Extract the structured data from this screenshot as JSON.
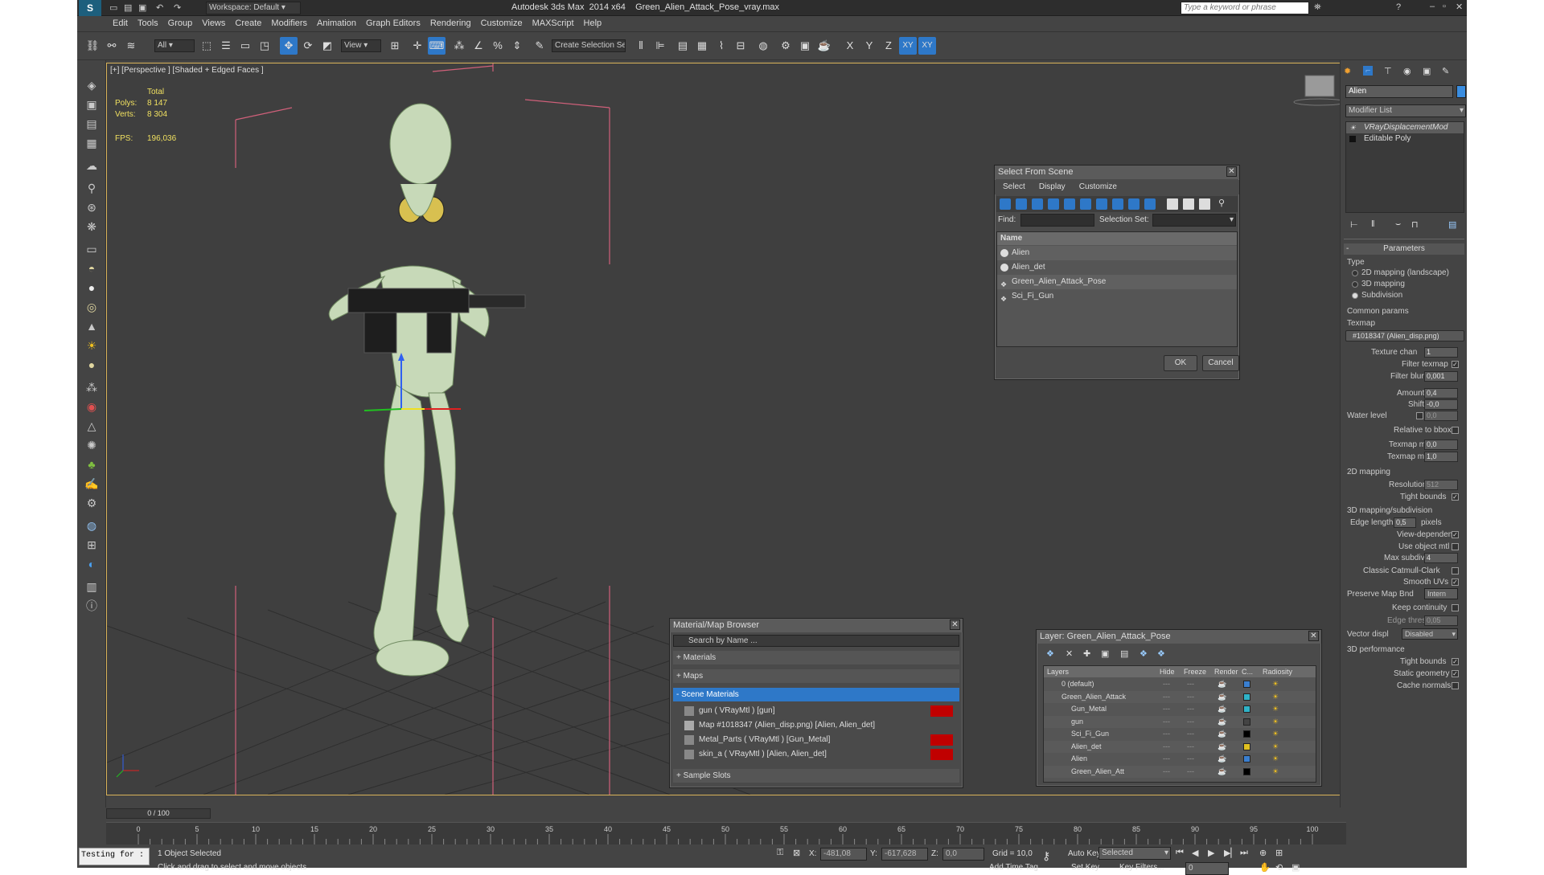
{
  "title": {
    "app": "Autodesk 3ds Max  2014 x64    Green_Alien_Attack_Pose_vray.max",
    "workspace": "Workspace: Default",
    "search_placeholder": "Type a keyword or phrase"
  },
  "menu": [
    "Edit",
    "Tools",
    "Group",
    "Views",
    "Create",
    "Modifiers",
    "Animation",
    "Graph Editors",
    "Rendering",
    "Customize",
    "MAXScript",
    "Help"
  ],
  "toolbar": {
    "filter": "All",
    "view": "View",
    "selection_set": "Create Selection Se",
    "axes": [
      "X",
      "Y",
      "Z",
      "XY",
      "XY"
    ]
  },
  "viewport": {
    "label": "[+] [Perspective ] [Shaded + Edged Faces ]",
    "stats_header": "Total",
    "polys_label": "Polys:",
    "polys": "8 147",
    "verts_label": "Verts:",
    "verts": "8 304",
    "fps_label": "FPS:",
    "fps": "196,036"
  },
  "select_dialog": {
    "title": "Select From Scene",
    "menu": [
      "Select",
      "Display",
      "Customize"
    ],
    "find_label": "Find:",
    "selset_label": "Selection Set:",
    "col_name": "Name",
    "items": [
      "Alien",
      "Alien_det",
      "Green_Alien_Attack_Pose",
      "Sci_Fi_Gun"
    ],
    "ok": "OK",
    "cancel": "Cancel"
  },
  "mat_browser": {
    "title": "Material/Map Browser",
    "search": "Search by Name ...",
    "groups": [
      "+ Materials",
      "+ Maps",
      "- Scene Materials"
    ],
    "items": [
      "gun  ( VRayMtl ) [gun]",
      "Map #1018347 (Alien_disp.png) [Alien, Alien_det]",
      "Metal_Parts  ( VRayMtl ) [Gun_Metal]",
      "skin_a  ( VRayMtl ) [Alien, Alien_det]"
    ],
    "sample_slots": "+ Sample Slots"
  },
  "layer_dialog": {
    "title": "Layer: Green_Alien_Attack_Pose",
    "cols": [
      "Layers",
      "Hide",
      "Freeze",
      "Render",
      "C...",
      "Radiosity"
    ],
    "rows": [
      {
        "name": "0 (default)",
        "color": "#3a7fd0"
      },
      {
        "name": "Green_Alien_Attack",
        "color": "#2fb3c8"
      },
      {
        "name": "Gun_Metal",
        "color": "#2fb3c8"
      },
      {
        "name": "gun",
        "color": "#444444"
      },
      {
        "name": "Sci_Fi_Gun",
        "color": "#000000"
      },
      {
        "name": "Alien_det",
        "color": "#e0c020"
      },
      {
        "name": "Alien",
        "color": "#3a7fd0"
      },
      {
        "name": "Green_Alien_Att",
        "color": "#000000"
      }
    ]
  },
  "cmd": {
    "object_name": "Alien",
    "modifier_list": "Modifier List",
    "stack": [
      "VRayDisplacementMod",
      "Editable Poly"
    ],
    "rollout": "Parameters",
    "type_label": "Type",
    "type_opts": [
      "2D mapping (landscape)",
      "3D mapping",
      "Subdivision"
    ],
    "common": "Common params",
    "texmap_label": "Texmap",
    "texmap": "#1018347 (Alien_disp.png)",
    "texture_chan": "Texture chan",
    "texture_chan_val": "1",
    "filter_texmap": "Filter texmap",
    "filter_blur": "Filter blur",
    "filter_blur_val": "0,001",
    "amount": "Amount",
    "amount_val": "0,4",
    "shift": "Shift",
    "shift_val": "-0,0",
    "water": "Water level",
    "water_val": "0,0",
    "rel_bbox": "Relative to bbox",
    "tex_min": "Texmap min",
    "tex_min_val": "0,0",
    "tex_max": "Texmap max",
    "tex_max_val": "1,0",
    "map2d": "2D mapping",
    "resolution": "Resolution",
    "resolution_val": "512",
    "tight": "Tight bounds",
    "map3d": "3D mapping/subdivision",
    "edge_len": "Edge length",
    "edge_len_val": "0,5",
    "pixels": "pixels",
    "view_dep": "View-dependent",
    "use_obj": "Use object mtl",
    "max_sub": "Max subdivs",
    "max_sub_val": "4",
    "catmull": "Classic Catmull-Clark",
    "smooth_uv": "Smooth UVs",
    "pres_map": "Preserve Map Bnd",
    "pres_map_val": "Intern",
    "keep": "Keep continuity",
    "edge_thr": "Edge thresh",
    "edge_thr_val": "0,05",
    "vec": "Vector displ",
    "vec_val": "Disabled",
    "perf": "3D performance",
    "tight2": "Tight bounds",
    "static": "Static geometry",
    "cache": "Cache normals"
  },
  "timeline": {
    "slider": "0 / 100",
    "ticks": [
      "0",
      "5",
      "10",
      "15",
      "20",
      "25",
      "30",
      "35",
      "40",
      "45",
      "50",
      "55",
      "60",
      "65",
      "70",
      "75",
      "80",
      "85",
      "90",
      "95",
      "100"
    ]
  },
  "status": {
    "maxscript": "Testing for :",
    "selected": "1 Object Selected",
    "prompt": "Click and drag to select and move objects",
    "x_label": "X:",
    "x": "-481,08",
    "y_label": "Y:",
    "y": "-617,628",
    "z_label": "Z:",
    "z": "0,0",
    "grid": "Grid = 10,0",
    "auto_key": "Auto Key",
    "selected_mode": "Selected",
    "set_key": "Set Key",
    "key_filters": "Key Filters...",
    "add_time_tag": "Add Time Tag",
    "frame": "0"
  }
}
